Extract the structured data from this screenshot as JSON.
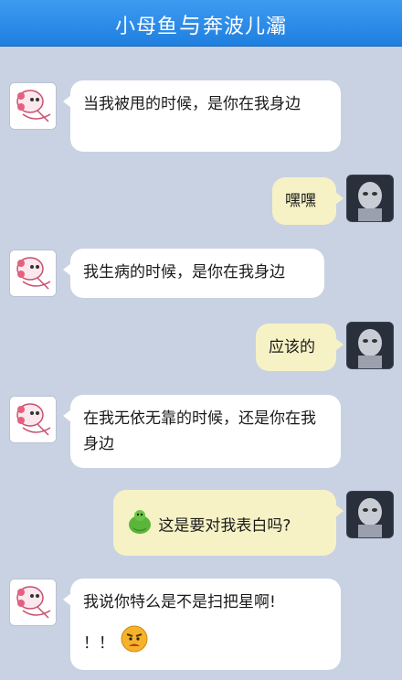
{
  "header": {
    "title_left": "小母鱼",
    "title_sep": "与",
    "title_right": "奔波儿灞"
  },
  "messages": [
    {
      "side": "left",
      "text": "当我被甩的时候，是你在我身边"
    },
    {
      "side": "right",
      "text": "嘿嘿"
    },
    {
      "side": "left",
      "text": "我生病的时候，是你在我身边"
    },
    {
      "side": "right",
      "text": "应该的"
    },
    {
      "side": "left",
      "text": "在我无依无靠的时候，还是你在我身边"
    },
    {
      "side": "right",
      "text": "这是要对我表白吗?",
      "emoji": "green-blob-emoji"
    },
    {
      "side": "left",
      "text": "我说你特么是不是扫把星啊!",
      "text2": "！！",
      "emoji": "angry-face-emoji"
    }
  ],
  "colors": {
    "background": "#c8d2e2",
    "header": "#2b8cea",
    "bubble_left": "#ffffff",
    "bubble_right": "#f6f2c6"
  },
  "icons": {
    "left_avatar": "pink-cartoon-avatar",
    "right_avatar": "robot-mask-avatar"
  }
}
